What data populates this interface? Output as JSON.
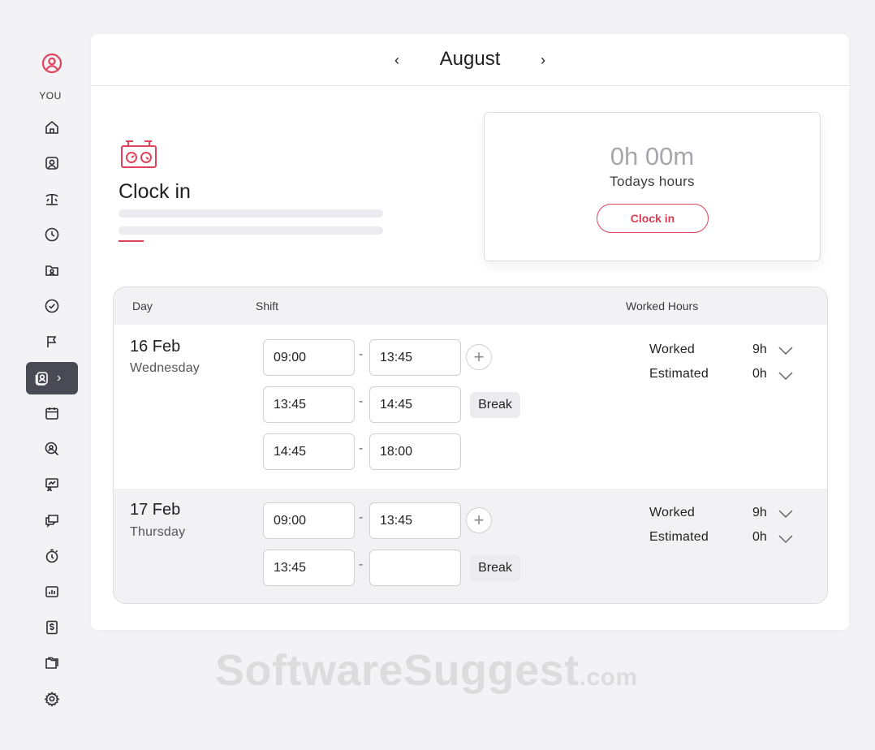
{
  "sidebar": {
    "user_label": "YOU",
    "items": [
      {
        "name": "home-icon"
      },
      {
        "name": "profile-icon"
      },
      {
        "name": "vacation-icon"
      },
      {
        "name": "clock-icon"
      },
      {
        "name": "folder-user-icon"
      },
      {
        "name": "check-circle-icon"
      },
      {
        "name": "flag-icon"
      },
      {
        "name": "timesheet-icon",
        "active": true
      },
      {
        "name": "calendar-icon"
      },
      {
        "name": "search-user-icon"
      },
      {
        "name": "training-icon"
      },
      {
        "name": "chat-icon"
      },
      {
        "name": "stopwatch-icon"
      },
      {
        "name": "report-chart-icon"
      },
      {
        "name": "dollar-doc-icon"
      },
      {
        "name": "files-icon"
      },
      {
        "name": "settings-icon"
      }
    ]
  },
  "header": {
    "month": "August"
  },
  "clock_in": {
    "title": "Clock in"
  },
  "today": {
    "hours": "0h 00m",
    "label": "Todays hours",
    "button": "Clock in"
  },
  "table": {
    "headers": {
      "day": "Day",
      "shift": "Shift",
      "worked_hours": "Worked Hours"
    },
    "rows": [
      {
        "date": "16 Feb",
        "weekday": "Wednesday",
        "shifts": [
          {
            "start": "09:00",
            "end": "13:45",
            "tag": ""
          },
          {
            "start": "13:45",
            "end": "14:45",
            "tag": "Break"
          },
          {
            "start": "14:45",
            "end": "18:00",
            "tag": ""
          }
        ],
        "worked_label": "Worked",
        "worked_value": "9h",
        "estimated_label": "Estimated",
        "estimated_value": "0h"
      },
      {
        "date": "17 Feb",
        "weekday": "Thursday",
        "shifts": [
          {
            "start": "09:00",
            "end": "13:45",
            "tag": ""
          },
          {
            "start": "13:45",
            "end": "",
            "tag": "Break"
          }
        ],
        "worked_label": "Worked",
        "worked_value": "9h",
        "estimated_label": "Estimated",
        "estimated_value": "0h"
      }
    ]
  },
  "watermark": {
    "main": "SoftwareSuggest",
    "suffix": ".com"
  },
  "colors": {
    "accent": "#e0435c",
    "active_nav": "#4a4a55"
  }
}
